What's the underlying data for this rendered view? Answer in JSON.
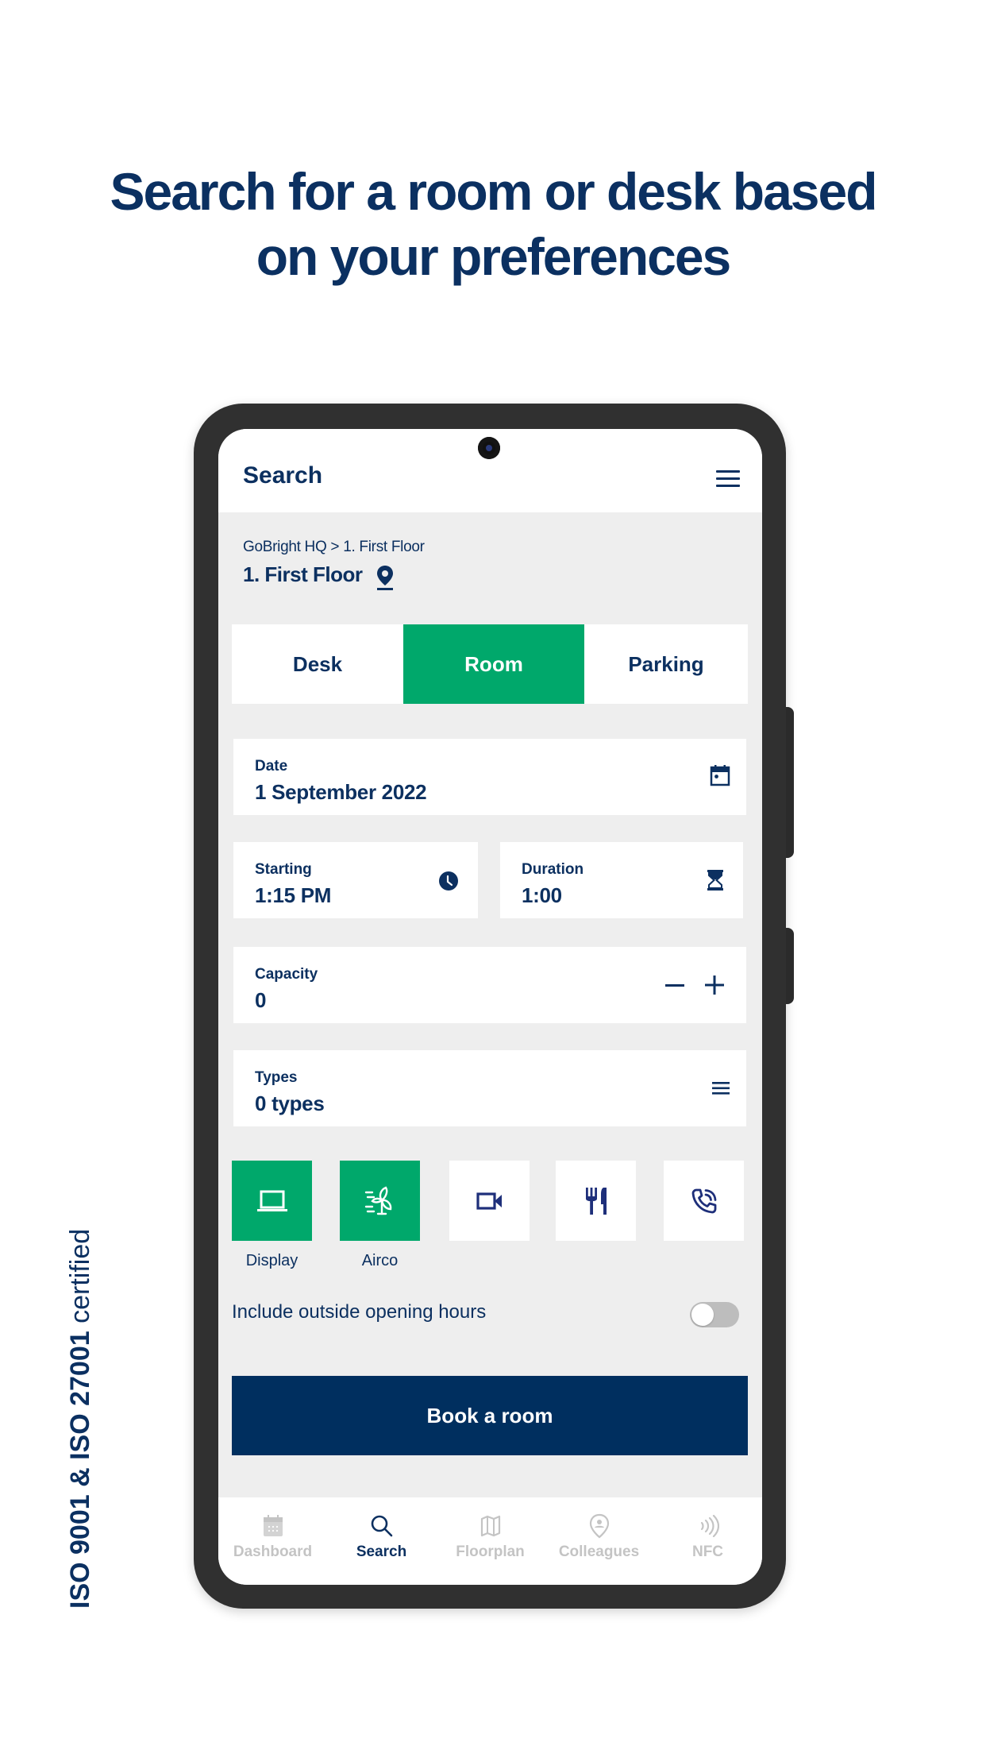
{
  "headline": {
    "line1": "Search for a room or desk based",
    "line2": "on your preferences"
  },
  "certification": {
    "bold": "ISO 9001 & ISO 27001",
    "regular": " certified"
  },
  "colors": {
    "navy": "#0c3060",
    "green": "#00a86b",
    "button": "#002f5f",
    "background": "#eeeeee",
    "inactive_nav": "#c4c4c4"
  },
  "app": {
    "title": "Search",
    "menu_icon": "hamburger-menu-icon",
    "breadcrumb": "GoBright HQ > 1. First Floor",
    "floor": "1. First Floor",
    "floor_icon": "location-pin-icon"
  },
  "tabs": [
    {
      "label": "Desk",
      "active": false
    },
    {
      "label": "Room",
      "active": true
    },
    {
      "label": "Parking",
      "active": false
    }
  ],
  "fields": {
    "date": {
      "label": "Date",
      "value": "1 September 2022",
      "icon": "calendar-icon"
    },
    "starting": {
      "label": "Starting",
      "value": "1:15 PM",
      "icon": "clock-icon"
    },
    "duration": {
      "label": "Duration",
      "value": "1:00",
      "icon": "hourglass-icon"
    },
    "capacity": {
      "label": "Capacity",
      "value": "0",
      "decrement": "−",
      "increment": "+"
    },
    "types": {
      "label": "Types",
      "value": "0 types",
      "icon": "list-icon"
    }
  },
  "amenities": [
    {
      "name": "Display",
      "icon": "laptop-icon",
      "selected": true,
      "label": "Display"
    },
    {
      "name": "Airco",
      "icon": "fan-icon",
      "selected": true,
      "label": "Airco"
    },
    {
      "name": "Video",
      "icon": "video-camera-icon",
      "selected": false,
      "label": ""
    },
    {
      "name": "Catering",
      "icon": "fork-knife-icon",
      "selected": false,
      "label": ""
    },
    {
      "name": "Phone",
      "icon": "phone-call-icon",
      "selected": false,
      "label": ""
    }
  ],
  "toggle": {
    "label": "Include outside opening hours",
    "on": false
  },
  "book_button": "Book a room",
  "bottom_nav": [
    {
      "label": "Dashboard",
      "icon": "calendar-icon",
      "active": false
    },
    {
      "label": "Search",
      "icon": "search-icon",
      "active": true
    },
    {
      "label": "Floorplan",
      "icon": "map-icon",
      "active": false
    },
    {
      "label": "Colleagues",
      "icon": "colleague-pin-icon",
      "active": false
    },
    {
      "label": "NFC",
      "icon": "nfc-icon",
      "active": false
    }
  ]
}
